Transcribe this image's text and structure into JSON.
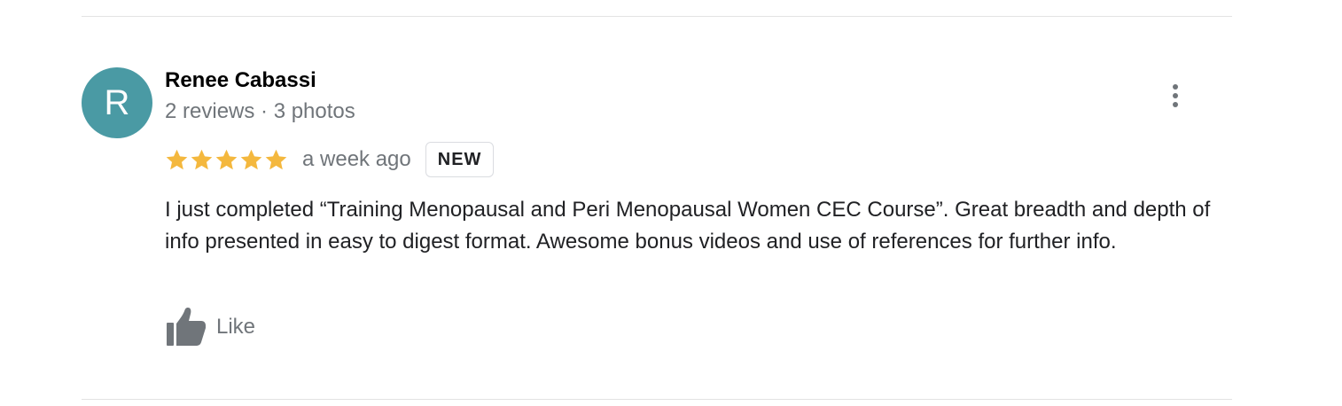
{
  "review": {
    "reviewer": {
      "avatar_initial": "R",
      "avatar_color": "#4a9aa4",
      "name": "Renee Cabassi",
      "meta": "2 reviews · 3 photos"
    },
    "rating": {
      "stars": 5,
      "max_stars": 5,
      "star_color": "#f4b83e",
      "star_icon": "star-icon"
    },
    "date": "a week ago",
    "badge": "NEW",
    "text": "I just completed “Training Menopausal and Peri Menopausal Women CEC Course”. Great breadth and depth of info presented in easy to digest format. Awesome bonus videos and use of references for further info.",
    "actions": {
      "like_label": "Like",
      "like_icon": "thumbs-up-icon",
      "more_icon": "more-vertical-icon"
    }
  }
}
